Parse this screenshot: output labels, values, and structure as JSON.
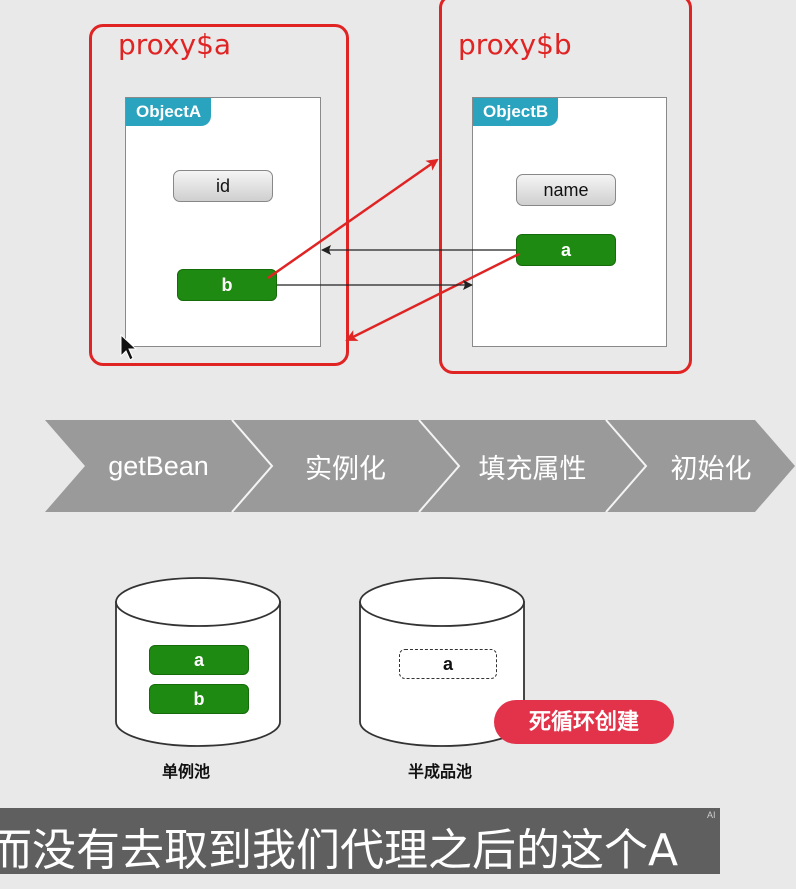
{
  "proxy_a": {
    "title": "proxy$a",
    "object_tag": "ObjectA",
    "field_plain": "id",
    "field_ref": "b"
  },
  "proxy_b": {
    "title": "proxy$b",
    "object_tag": "ObjectB",
    "field_plain": "name",
    "field_ref": "a"
  },
  "flow_steps": [
    "getBean",
    "实例化",
    "填充属性",
    "初始化"
  ],
  "singleton_pool": {
    "label": "单例池",
    "items": [
      "a",
      "b"
    ]
  },
  "half_pool": {
    "label": "半成品池",
    "item": "a"
  },
  "warning_badge": "死循环创建",
  "subtitle": "而没有去取到我们代理之后的这个A",
  "watermark": "AI",
  "colors": {
    "proxy_border": "#e02424",
    "object_tag": "#2aa3bf",
    "green_field": "#1f8a12",
    "badge": "#e2334a",
    "arrow_black": "#222222"
  }
}
